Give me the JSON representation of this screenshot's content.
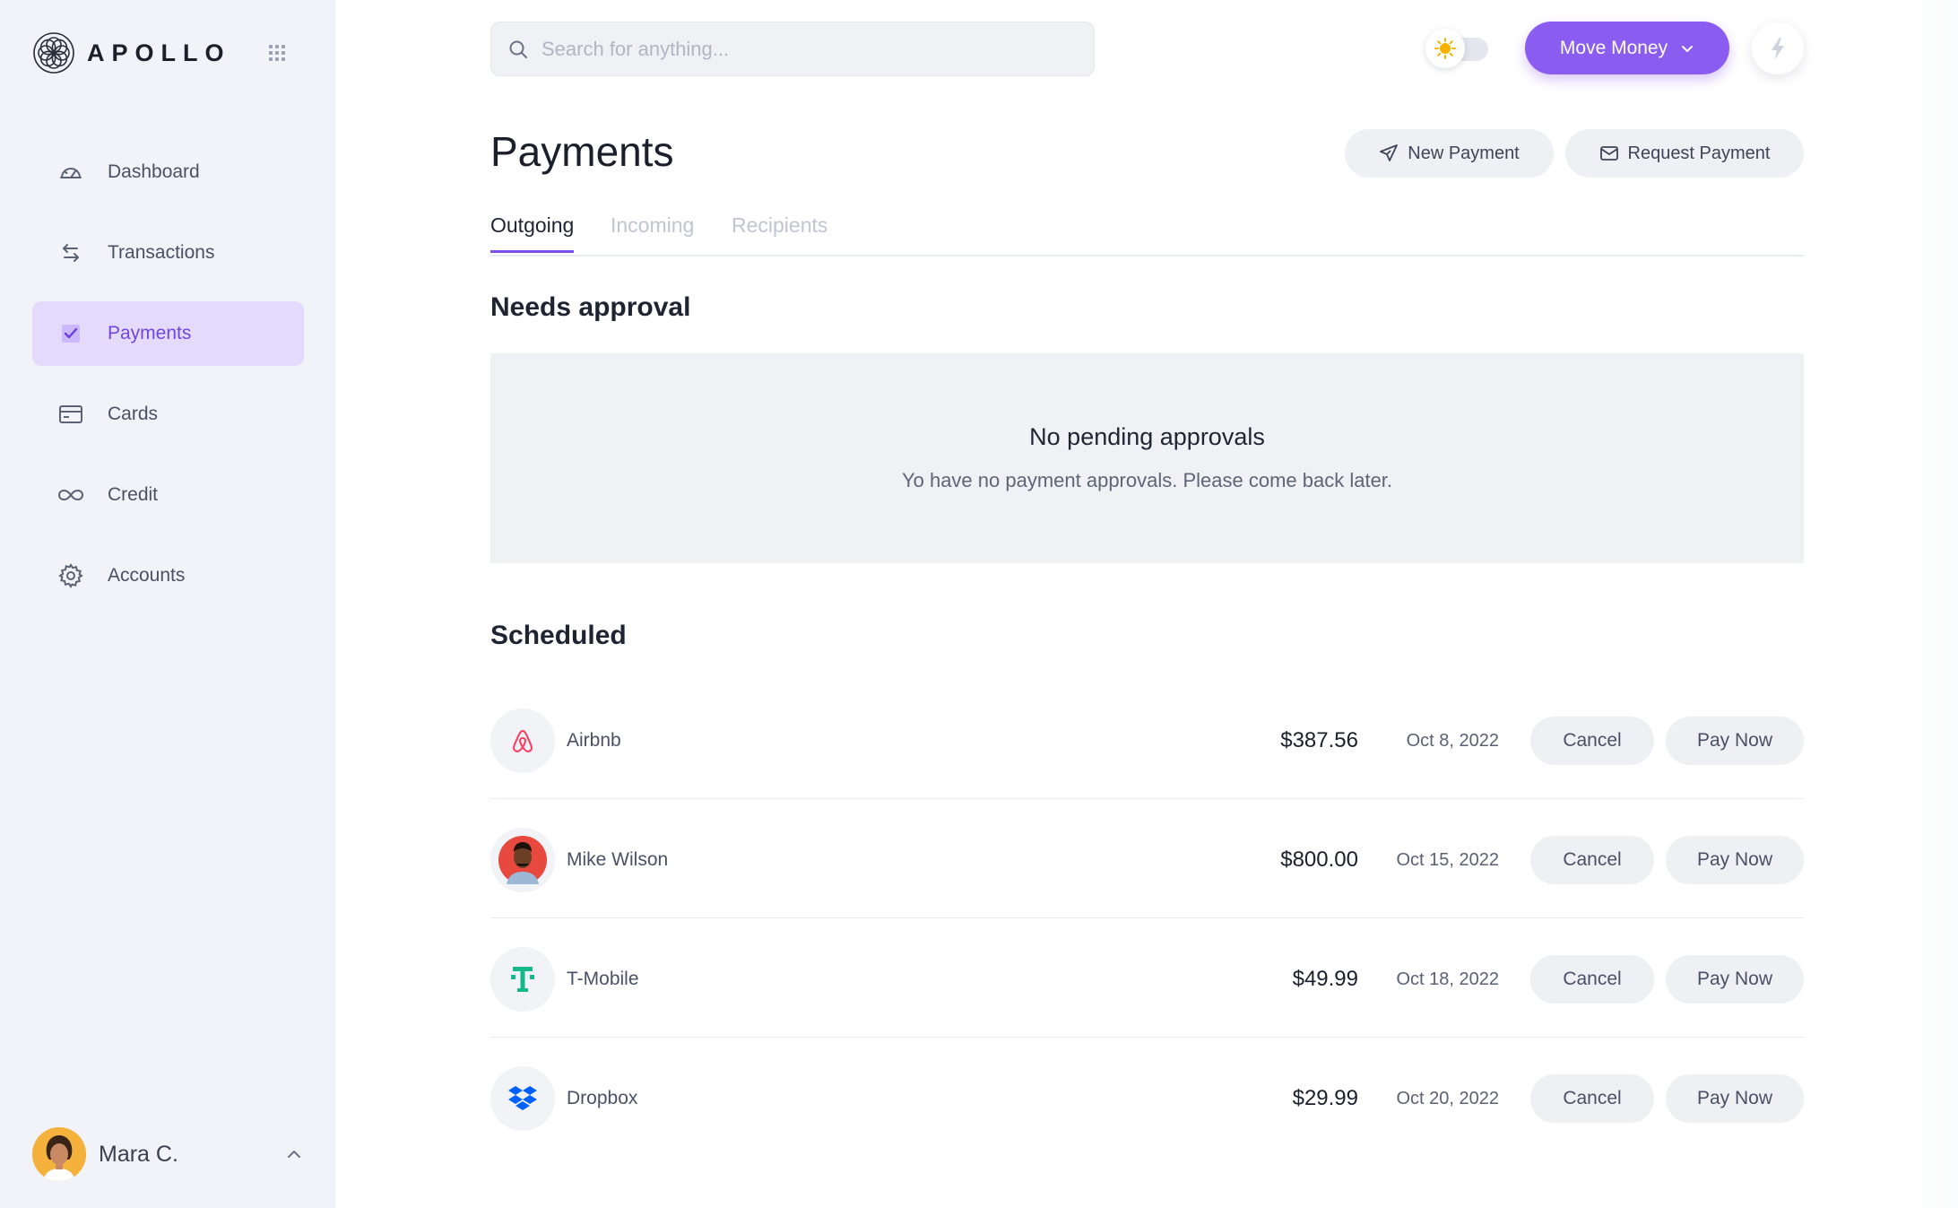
{
  "app": {
    "name": "APOLLO"
  },
  "sidebar": {
    "items": [
      {
        "label": "Dashboard",
        "icon": "dashboard-gauge-icon",
        "active": false
      },
      {
        "label": "Transactions",
        "icon": "transfer-arrows-icon",
        "active": false
      },
      {
        "label": "Payments",
        "icon": "checkbox-icon",
        "active": true
      },
      {
        "label": "Cards",
        "icon": "credit-card-icon",
        "active": false
      },
      {
        "label": "Credit",
        "icon": "infinity-icon",
        "active": false
      },
      {
        "label": "Accounts",
        "icon": "settings-gear-icon",
        "active": false
      }
    ],
    "user": {
      "name": "Mara C."
    }
  },
  "topbar": {
    "search": {
      "placeholder": "Search for anything...",
      "value": ""
    },
    "move_money_label": "Move Money",
    "theme": "light"
  },
  "header": {
    "title": "Payments",
    "new_payment_label": "New Payment",
    "request_payment_label": "Request Payment"
  },
  "tabs": [
    {
      "label": "Outgoing",
      "active": true
    },
    {
      "label": "Incoming",
      "active": false
    },
    {
      "label": "Recipients",
      "active": false
    }
  ],
  "needs_approval": {
    "title": "Needs approval",
    "empty_title": "No pending approvals",
    "empty_message": "Yo have no payment approvals. Please come back later."
  },
  "scheduled": {
    "title": "Scheduled",
    "cancel_label": "Cancel",
    "pay_now_label": "Pay Now",
    "rows": [
      {
        "payee": "Airbnb",
        "amount": "$387.56",
        "date": "Oct 8, 2022",
        "logo": "airbnb-logo-icon"
      },
      {
        "payee": "Mike Wilson",
        "amount": "$800.00",
        "date": "Oct 15, 2022",
        "logo": "person-avatar"
      },
      {
        "payee": "T-Mobile",
        "amount": "$49.99",
        "date": "Oct 18, 2022",
        "logo": "tmobile-logo-icon"
      },
      {
        "payee": "Dropbox",
        "amount": "$29.99",
        "date": "Oct 20, 2022",
        "logo": "dropbox-logo-icon"
      }
    ]
  },
  "colors": {
    "accent": "#8b5cf0",
    "sidebar_bg": "#f1f3f8",
    "active_nav_bg": "#e3dafc",
    "active_nav_text": "#7346de",
    "muted_bg": "#eff1f5"
  }
}
